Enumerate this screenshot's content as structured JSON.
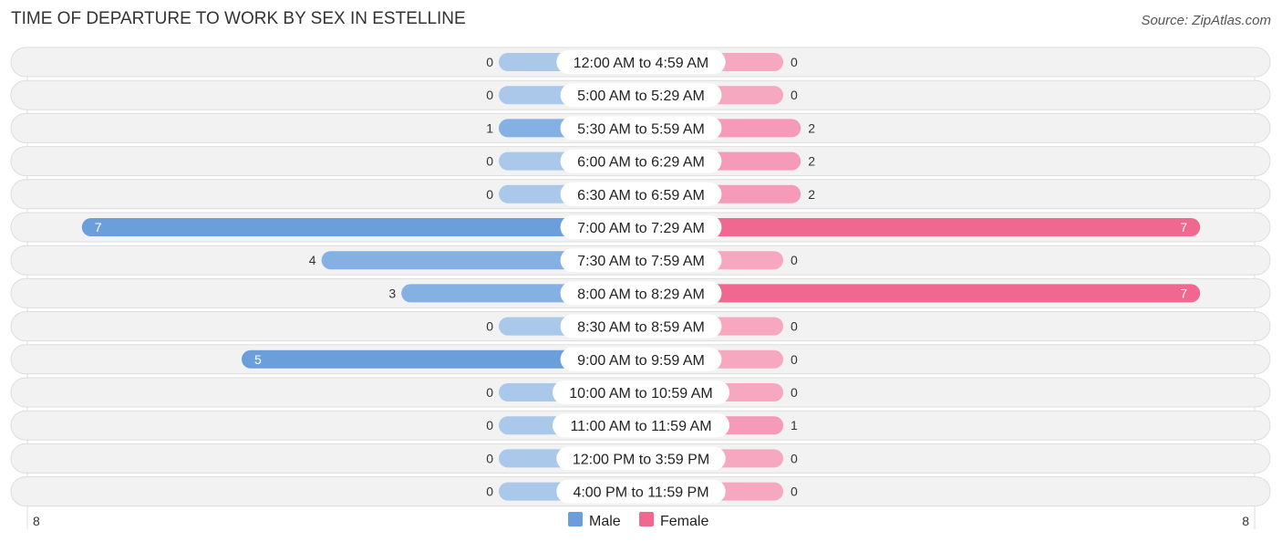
{
  "header": {
    "title": "TIME OF DEPARTURE TO WORK BY SEX IN ESTELLINE",
    "source": "Source: ZipAtlas.com"
  },
  "chart_data": {
    "type": "bar",
    "orientation": "horizontal-butterfly",
    "title": "TIME OF DEPARTURE TO WORK BY SEX IN ESTELLINE",
    "categories": [
      "12:00 AM to 4:59 AM",
      "5:00 AM to 5:29 AM",
      "5:30 AM to 5:59 AM",
      "6:00 AM to 6:29 AM",
      "6:30 AM to 6:59 AM",
      "7:00 AM to 7:29 AM",
      "7:30 AM to 7:59 AM",
      "8:00 AM to 8:29 AM",
      "8:30 AM to 8:59 AM",
      "9:00 AM to 9:59 AM",
      "10:00 AM to 10:59 AM",
      "11:00 AM to 11:59 AM",
      "12:00 PM to 3:59 PM",
      "4:00 PM to 11:59 PM"
    ],
    "series": [
      {
        "name": "Male",
        "color": "#6a9fdc",
        "values": [
          0,
          0,
          1,
          0,
          0,
          7,
          4,
          3,
          0,
          5,
          0,
          0,
          0,
          0
        ]
      },
      {
        "name": "Female",
        "color": "#f0678f",
        "values": [
          0,
          0,
          2,
          2,
          2,
          7,
          0,
          7,
          0,
          0,
          0,
          1,
          0,
          0
        ]
      }
    ],
    "axis": {
      "left_label": "8",
      "right_label": "8",
      "range": [
        -8,
        8
      ]
    },
    "legend": {
      "position": "bottom-center",
      "entries": [
        "Male",
        "Female"
      ]
    }
  }
}
